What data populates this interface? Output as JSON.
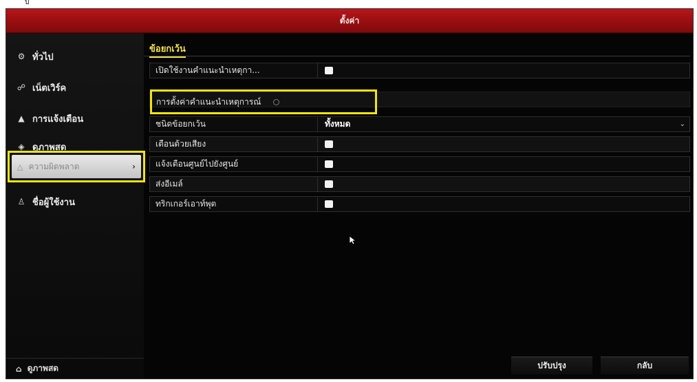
{
  "top_mark": "ป",
  "window": {
    "title": "ตั้งค่า"
  },
  "sidebar": {
    "items": [
      {
        "label": "ทั่วไป",
        "icon": "gear-icon",
        "glyph": "⚙"
      },
      {
        "label": "เน็ตเวิร์ค",
        "icon": "network-icon",
        "glyph": "☍"
      },
      {
        "label": "การแจ้งเตือน",
        "icon": "bell-icon",
        "glyph": "▲"
      },
      {
        "label": "ดูภาพสด",
        "icon": "eye-icon",
        "glyph": "◈"
      },
      {
        "label": "ความผิดพลาด",
        "icon": "warning-icon",
        "glyph": "△",
        "active": true
      },
      {
        "label": "ชื่อผู้ใช้งาน",
        "icon": "user-icon",
        "glyph": "♙"
      }
    ],
    "active_chevron": "›",
    "footer": {
      "label": "ดูภาพสด",
      "icon": "home-icon",
      "glyph": "⌂"
    }
  },
  "main": {
    "tab": "ข้อยกเว้น",
    "rows": [
      {
        "label": "เปิดใช้งานคำแนะนำเหตุกา...",
        "type": "checkbox",
        "checked": true
      },
      {
        "label": "การตั้งค่าคำแนะนำเหตุการณ์",
        "type": "radio"
      },
      {
        "label": "ชนิดข้อยกเว้น",
        "type": "dropdown",
        "value": "ทั้งหมด"
      },
      {
        "label": "เตือนด้วยเสียง",
        "type": "checkbox",
        "checked": true
      },
      {
        "label": "แจ้งเตือนศูนย์ไปยังศูนย์",
        "type": "checkbox",
        "checked": true
      },
      {
        "label": "ส่งอีเมล์",
        "type": "checkbox",
        "checked": true
      },
      {
        "label": "ทริกเกอร์เอาท์พุต",
        "type": "checkbox",
        "checked": true
      }
    ],
    "dropdown_caret": "⌄"
  },
  "buttons": {
    "apply": "ปรับปรุง",
    "back": "กลับ"
  },
  "colors": {
    "titlebar": "#9e0f12",
    "accent": "#f4e04a",
    "highlight_box": "#f0e410"
  }
}
